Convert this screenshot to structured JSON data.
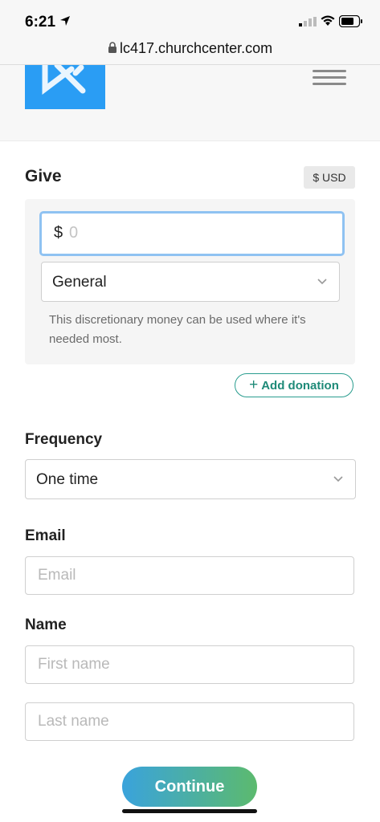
{
  "status_bar": {
    "time": "6:21"
  },
  "browser": {
    "url": "lc417.churchcenter.com"
  },
  "give": {
    "title": "Give",
    "currency": "$ USD",
    "amount_symbol": "$",
    "amount_placeholder": "0",
    "fund_selected": "General",
    "fund_description": "This discretionary money can be used where it's needed most.",
    "add_donation_label": "Add donation"
  },
  "frequency": {
    "label": "Frequency",
    "selected": "One time"
  },
  "email": {
    "label": "Email",
    "placeholder": "Email"
  },
  "name": {
    "label": "Name",
    "first_placeholder": "First name",
    "last_placeholder": "Last name"
  },
  "continue_label": "Continue",
  "colors": {
    "logo_blue": "#2a9df4",
    "accent_green": "#1e8a78",
    "input_focus": "#8fc2f2"
  }
}
